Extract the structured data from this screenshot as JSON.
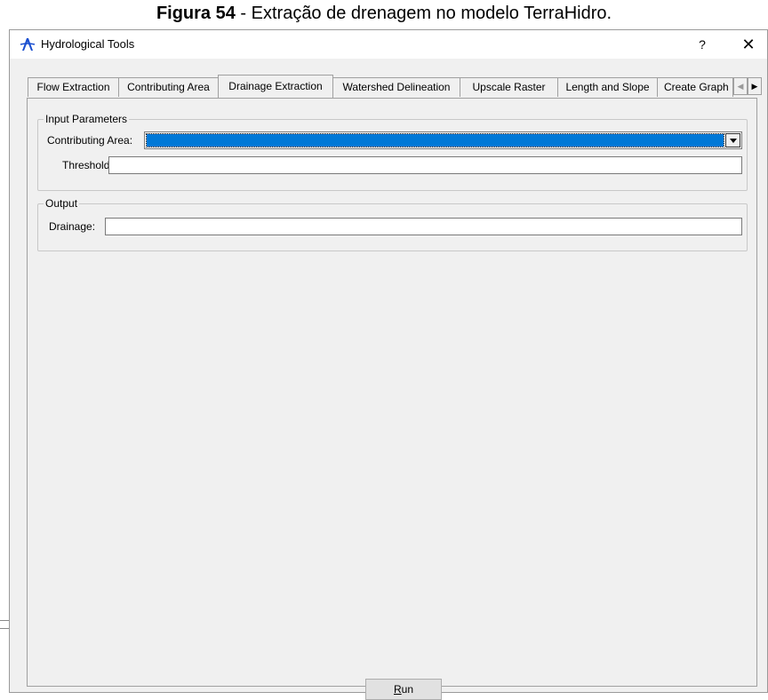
{
  "caption": {
    "figure_label": "Figura 54",
    "text": " - Extração de drenagem no modelo TerraHidro."
  },
  "window": {
    "title": "Hydrological Tools",
    "help_label": "?",
    "close_label": "✕"
  },
  "tabs": [
    {
      "label": "Flow Extraction",
      "active": false
    },
    {
      "label": "Contributing Area",
      "active": false
    },
    {
      "label": "Drainage Extraction",
      "active": true
    },
    {
      "label": "Watershed Delineation",
      "active": false
    },
    {
      "label": "Upscale Raster",
      "active": false
    },
    {
      "label": "Length and Slope",
      "active": false
    },
    {
      "label": "Create Graph",
      "active": false
    }
  ],
  "tab_scroll": {
    "left": "◀",
    "right": "▶"
  },
  "input_parameters": {
    "title": "Input Parameters",
    "contributing_area_label": "Contributing Area:",
    "contributing_area_value": "",
    "threshold_label": "Threshold:",
    "threshold_value": ""
  },
  "output": {
    "title": "Output",
    "drainage_label": "Drainage:",
    "drainage_value": ""
  },
  "run_button": {
    "label": "Run",
    "mnemonic": "R",
    "rest": "un"
  },
  "colors": {
    "selection": "#0078d7",
    "dialog_bg": "#f0f0f0",
    "icon_blue": "#1a4fd0"
  }
}
